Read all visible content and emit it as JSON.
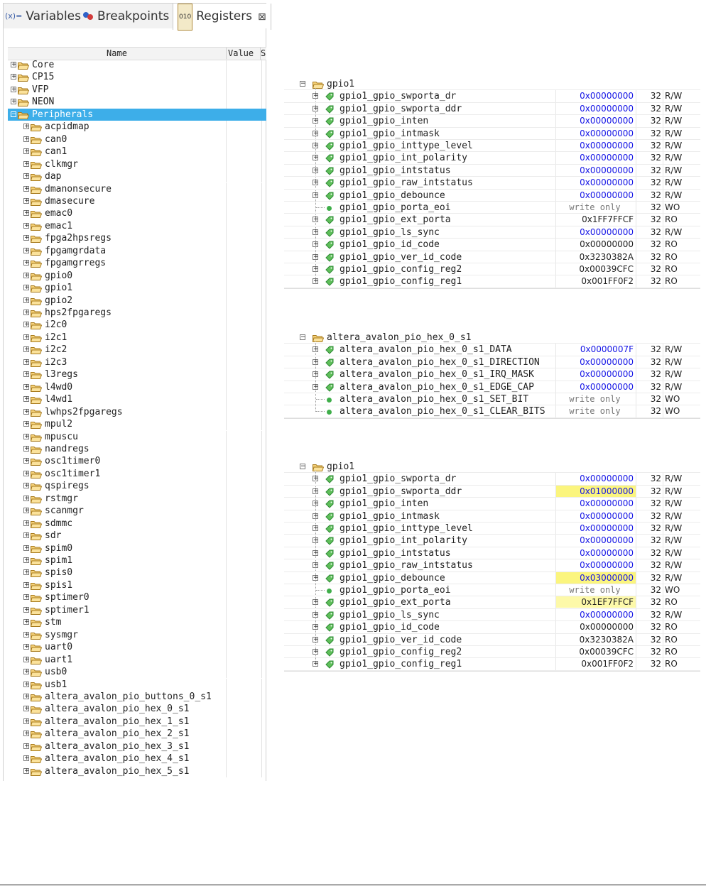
{
  "tabs": [
    {
      "label": "Variables",
      "icon": "variables-icon",
      "icon_text": "(x)="
    },
    {
      "label": "Breakpoints",
      "icon": "breakpoints-icon"
    },
    {
      "label": "Registers",
      "icon": "registers-icon",
      "icon_text": "010",
      "active": true
    }
  ],
  "tree": {
    "columns": {
      "name": "Name",
      "value": "Value",
      "size": "S"
    },
    "top_items": [
      "Core",
      "CP15",
      "VFP",
      "NEON"
    ],
    "selected": "Peripherals",
    "peripherals": [
      "acpidmap",
      "can0",
      "can1",
      "clkmgr",
      "dap",
      "dmanonsecure",
      "dmasecure",
      "emac0",
      "emac1",
      "fpga2hpsregs",
      "fpgamgrdata",
      "fpgamgrregs",
      "gpio0",
      "gpio1",
      "gpio2",
      "hps2fpgaregs",
      "i2c0",
      "i2c1",
      "i2c2",
      "i2c3",
      "l3regs",
      "l4wd0",
      "l4wd1",
      "lwhps2fpgaregs",
      "mpul2",
      "mpuscu",
      "nandregs",
      "osc1timer0",
      "osc1timer1",
      "qspiregs",
      "rstmgr",
      "scanmgr",
      "sdmmc",
      "sdr",
      "spim0",
      "spim1",
      "spis0",
      "spis1",
      "sptimer0",
      "sptimer1",
      "stm",
      "sysmgr",
      "uart0",
      "uart1",
      "usb0",
      "usb1",
      "altera_avalon_pio_buttons_0_s1",
      "altera_avalon_pio_hex_0_s1",
      "altera_avalon_pio_hex_1_s1",
      "altera_avalon_pio_hex_2_s1",
      "altera_avalon_pio_hex_3_s1",
      "altera_avalon_pio_hex_4_s1",
      "altera_avalon_pio_hex_5_s1"
    ]
  },
  "panels": [
    {
      "group": "gpio1",
      "rows": [
        {
          "name": "gpio1_gpio_swporta_dr",
          "value": "0x00000000",
          "style": "blue",
          "size": "32",
          "access": "R/W",
          "leaf": false
        },
        {
          "name": "gpio1_gpio_swporta_ddr",
          "value": "0x00000000",
          "style": "blue",
          "size": "32",
          "access": "R/W",
          "leaf": false
        },
        {
          "name": "gpio1_gpio_inten",
          "value": "0x00000000",
          "style": "blue",
          "size": "32",
          "access": "R/W",
          "leaf": false
        },
        {
          "name": "gpio1_gpio_intmask",
          "value": "0x00000000",
          "style": "blue",
          "size": "32",
          "access": "R/W",
          "leaf": false
        },
        {
          "name": "gpio1_gpio_inttype_level",
          "value": "0x00000000",
          "style": "blue",
          "size": "32",
          "access": "R/W",
          "leaf": false
        },
        {
          "name": "gpio1_gpio_int_polarity",
          "value": "0x00000000",
          "style": "blue",
          "size": "32",
          "access": "R/W",
          "leaf": false
        },
        {
          "name": "gpio1_gpio_intstatus",
          "value": "0x00000000",
          "style": "blue",
          "size": "32",
          "access": "R/W",
          "leaf": false
        },
        {
          "name": "gpio1_gpio_raw_intstatus",
          "value": "0x00000000",
          "style": "blue",
          "size": "32",
          "access": "R/W",
          "leaf": false
        },
        {
          "name": "gpio1_gpio_debounce",
          "value": "0x00000000",
          "style": "blue",
          "size": "32",
          "access": "R/W",
          "leaf": false
        },
        {
          "name": "gpio1_gpio_porta_eoi",
          "value": "write only",
          "style": "gray",
          "size": "32",
          "access": "WO",
          "leaf": true
        },
        {
          "name": "gpio1_gpio_ext_porta",
          "value": "0x1FF7FFCF",
          "style": "black",
          "size": "32",
          "access": "RO",
          "leaf": false
        },
        {
          "name": "gpio1_gpio_ls_sync",
          "value": "0x00000000",
          "style": "blue",
          "size": "32",
          "access": "R/W",
          "leaf": false
        },
        {
          "name": "gpio1_gpio_id_code",
          "value": "0x00000000",
          "style": "black",
          "size": "32",
          "access": "RO",
          "leaf": false
        },
        {
          "name": "gpio1_gpio_ver_id_code",
          "value": "0x3230382A",
          "style": "black",
          "size": "32",
          "access": "RO",
          "leaf": false
        },
        {
          "name": "gpio1_gpio_config_reg2",
          "value": "0x00039CFC",
          "style": "black",
          "size": "32",
          "access": "RO",
          "leaf": false
        },
        {
          "name": "gpio1_gpio_config_reg1",
          "value": "0x001FF0F2",
          "style": "black",
          "size": "32",
          "access": "RO",
          "leaf": false
        }
      ]
    },
    {
      "group": "altera_avalon_pio_hex_0_s1",
      "rows": [
        {
          "name": "altera_avalon_pio_hex_0_s1_DATA",
          "value": "0x0000007F",
          "style": "blue",
          "size": "32",
          "access": "R/W",
          "leaf": false
        },
        {
          "name": "altera_avalon_pio_hex_0_s1_DIRECTION",
          "value": "0x00000000",
          "style": "blue",
          "size": "32",
          "access": "R/W",
          "leaf": false
        },
        {
          "name": "altera_avalon_pio_hex_0_s1_IRQ_MASK",
          "value": "0x00000000",
          "style": "blue",
          "size": "32",
          "access": "R/W",
          "leaf": false
        },
        {
          "name": "altera_avalon_pio_hex_0_s1_EDGE_CAP",
          "value": "0x00000000",
          "style": "blue",
          "size": "32",
          "access": "R/W",
          "leaf": false
        },
        {
          "name": "altera_avalon_pio_hex_0_s1_SET_BIT",
          "value": "write only",
          "style": "gray",
          "size": "32",
          "access": "WO",
          "leaf": true
        },
        {
          "name": "altera_avalon_pio_hex_0_s1_CLEAR_BITS",
          "value": "write only",
          "style": "gray",
          "size": "32",
          "access": "WO",
          "leaf": true
        }
      ]
    },
    {
      "group": "gpio1",
      "rows": [
        {
          "name": "gpio1_gpio_swporta_dr",
          "value": "0x00000000",
          "style": "blue",
          "size": "32",
          "access": "R/W",
          "leaf": false
        },
        {
          "name": "gpio1_gpio_swporta_ddr",
          "value": "0x01000000",
          "style": "blue-yellow",
          "size": "32",
          "access": "R/W",
          "leaf": false
        },
        {
          "name": "gpio1_gpio_inten",
          "value": "0x00000000",
          "style": "blue",
          "size": "32",
          "access": "R/W",
          "leaf": false
        },
        {
          "name": "gpio1_gpio_intmask",
          "value": "0x00000000",
          "style": "blue",
          "size": "32",
          "access": "R/W",
          "leaf": false
        },
        {
          "name": "gpio1_gpio_inttype_level",
          "value": "0x00000000",
          "style": "blue",
          "size": "32",
          "access": "R/W",
          "leaf": false
        },
        {
          "name": "gpio1_gpio_int_polarity",
          "value": "0x00000000",
          "style": "blue",
          "size": "32",
          "access": "R/W",
          "leaf": false
        },
        {
          "name": "gpio1_gpio_intstatus",
          "value": "0x00000000",
          "style": "blue",
          "size": "32",
          "access": "R/W",
          "leaf": false
        },
        {
          "name": "gpio1_gpio_raw_intstatus",
          "value": "0x00000000",
          "style": "blue",
          "size": "32",
          "access": "R/W",
          "leaf": false
        },
        {
          "name": "gpio1_gpio_debounce",
          "value": "0x03000000",
          "style": "blue-yellow",
          "size": "32",
          "access": "R/W",
          "leaf": false
        },
        {
          "name": "gpio1_gpio_porta_eoi",
          "value": "write only",
          "style": "gray",
          "size": "32",
          "access": "WO",
          "leaf": true
        },
        {
          "name": "gpio1_gpio_ext_porta",
          "value": "0x1EF7FFCF",
          "style": "black-yellow",
          "size": "32",
          "access": "RO",
          "leaf": false
        },
        {
          "name": "gpio1_gpio_ls_sync",
          "value": "0x00000000",
          "style": "blue",
          "size": "32",
          "access": "R/W",
          "leaf": false
        },
        {
          "name": "gpio1_gpio_id_code",
          "value": "0x00000000",
          "style": "black",
          "size": "32",
          "access": "RO",
          "leaf": false
        },
        {
          "name": "gpio1_gpio_ver_id_code",
          "value": "0x3230382A",
          "style": "black",
          "size": "32",
          "access": "RO",
          "leaf": false
        },
        {
          "name": "gpio1_gpio_config_reg2",
          "value": "0x00039CFC",
          "style": "black",
          "size": "32",
          "access": "RO",
          "leaf": false
        },
        {
          "name": "gpio1_gpio_config_reg1",
          "value": "0x001FF0F2",
          "style": "black",
          "size": "32",
          "access": "RO",
          "leaf": false
        }
      ]
    }
  ],
  "colors": {
    "selection": "#3daee9",
    "changed_value": "#fbf57e",
    "value_blue": "#1515e6",
    "folder": "#e8b84a",
    "register_green": "#3fae4a"
  }
}
